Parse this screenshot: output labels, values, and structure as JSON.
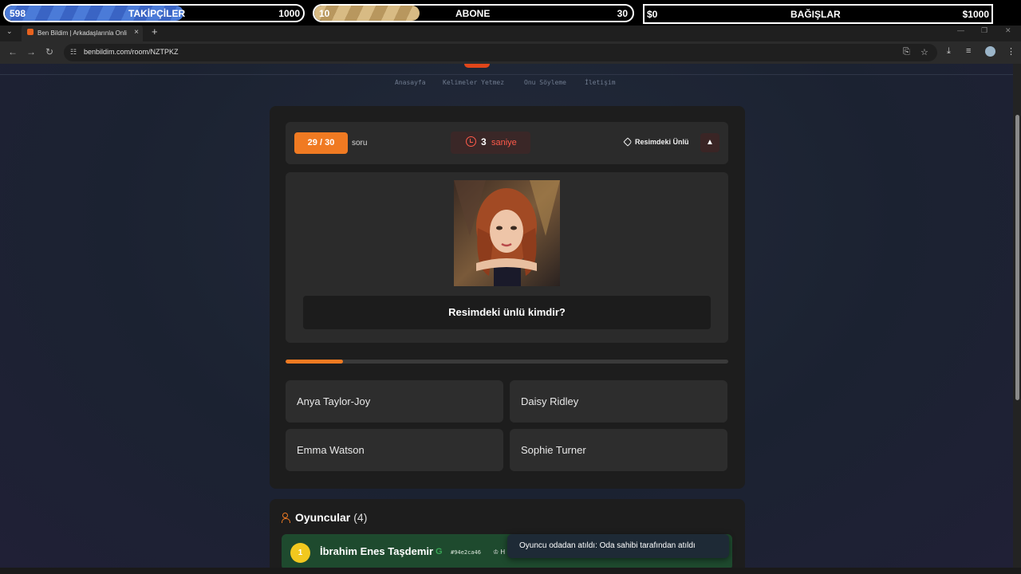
{
  "overlay": {
    "followers": {
      "current": "598",
      "label": "TAKİPÇİLER",
      "goal": "1000",
      "progress": 0.6
    },
    "subscribers": {
      "current": "10",
      "label": "ABONE",
      "goal": "30",
      "progress": 0.33
    },
    "donations": {
      "current": "$0",
      "label": "BAĞIŞLAR",
      "goal": "$1000",
      "progress": 0
    }
  },
  "browser": {
    "tab_title": "Ben Bildim | Arkadaşlarınla Onli",
    "url": "benbildim.com/room/NZTPKZ"
  },
  "site_nav": [
    "Anasayfa",
    "Kelimeler Yetmez",
    "Onu Söyleme",
    "İletişim"
  ],
  "game": {
    "counter": "29 / 30",
    "counter_suffix": "soru",
    "timer_value": "3",
    "timer_label": "saniye",
    "category": "Resimdeki Ünlü",
    "report_icon": "warning-icon",
    "question": "Resimdeki ünlü kimdir?",
    "time_progress": 0.13,
    "answers": [
      "Anya Taylor-Joy",
      "Daisy Ridley",
      "Emma Watson",
      "Sophie Turner"
    ]
  },
  "players": {
    "title": "Oyuncular",
    "count": "(4)",
    "list": [
      {
        "rank": "1",
        "name": "İbrahim Enes Taşdemir",
        "provider_icon": "google-icon",
        "id": "#94e2ca46",
        "badge": "H"
      }
    ]
  },
  "toast": "Oyuncu odadan atıldı: Oda sahibi tarafından atıldı",
  "colors": {
    "accent": "#f07a22",
    "timer": "#ff5a4a",
    "winner_row": "#1e4a2e"
  }
}
